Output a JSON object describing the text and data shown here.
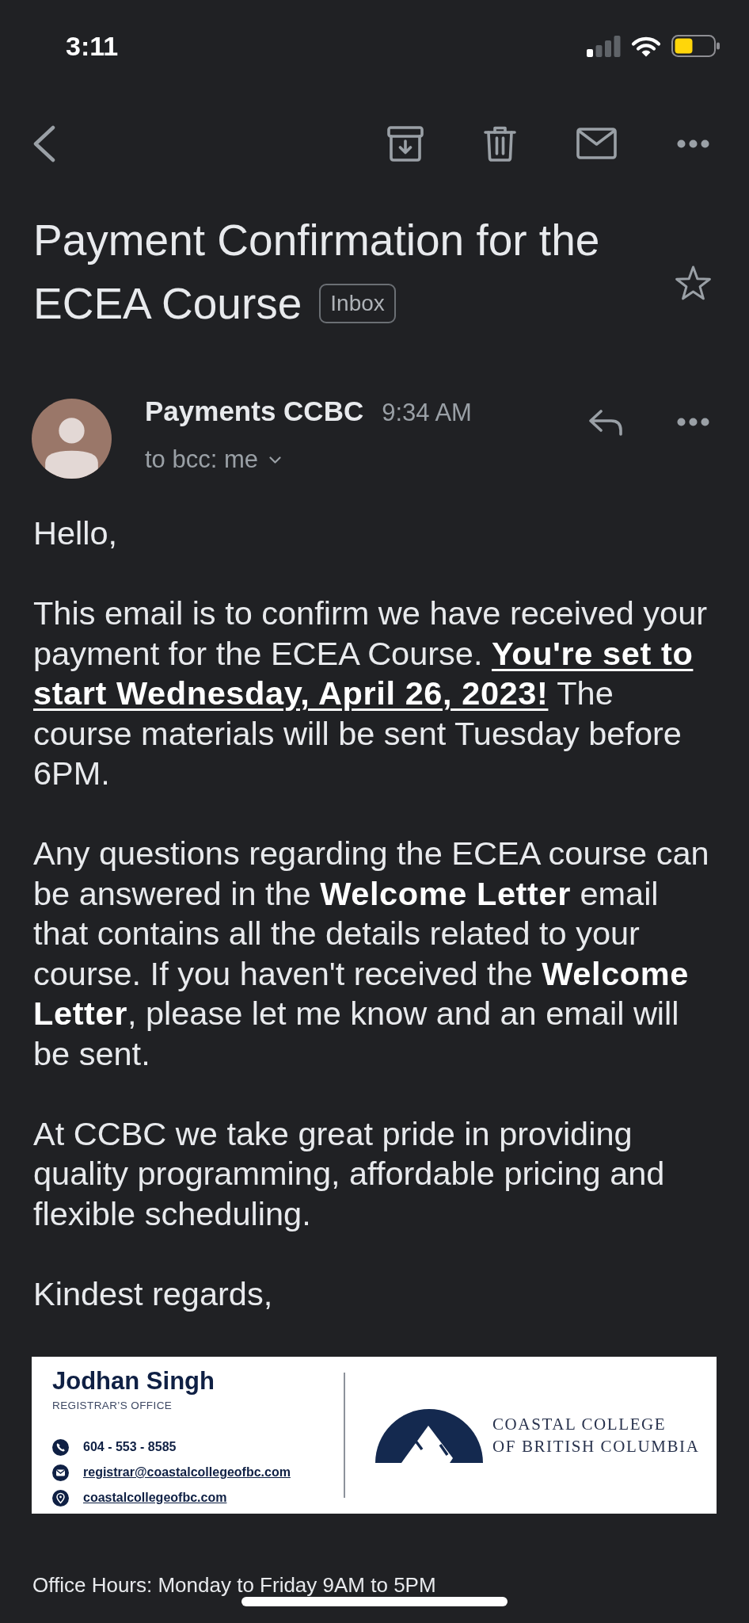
{
  "status_bar": {
    "time": "3:11"
  },
  "subject": {
    "title_lines": [
      "Payment Confirmation for the",
      "ECEA Course"
    ],
    "label": "Inbox",
    "starred": false
  },
  "message": {
    "sender": "Payments CCBC",
    "time": "9:34 AM",
    "recipients": "to bcc: me",
    "body": [
      {
        "text": "Hello,"
      },
      {
        "text": "This email is to confirm we have received your payment for the ECEA Course. **You're set to start Wednesday, April 26, 2023!** The course materials will be sent Tuesday before 6PM.",
        "underlined_bold": true
      },
      {
        "text": "Any questions regarding the ECEA course can be answered in the **Welcome Letter** email that contains all the details related to your course. If you haven't received the **Welcome Letter**, please let me know and an email will be sent."
      },
      {
        "text": "At CCBC we take great pride in providing quality programming, affordable pricing and flexible scheduling."
      },
      {
        "text": "Kindest regards,"
      }
    ],
    "signature": {
      "name": "Jodhan Singh",
      "office": "REGISTRAR’S OFFICE",
      "contacts": [
        {
          "kind": "phone",
          "text": "604 - 553 - 8585"
        },
        {
          "kind": "email",
          "text": "registrar@coastalcollegeofbc.com"
        },
        {
          "kind": "website",
          "text": "coastalcollegeofbc.com"
        }
      ],
      "college_name": [
        "COASTAL COLLEGE",
        "OF BRITISH COLUMBIA"
      ]
    },
    "footer": "Office Hours: Monday to Friday 9AM to 5PM"
  }
}
